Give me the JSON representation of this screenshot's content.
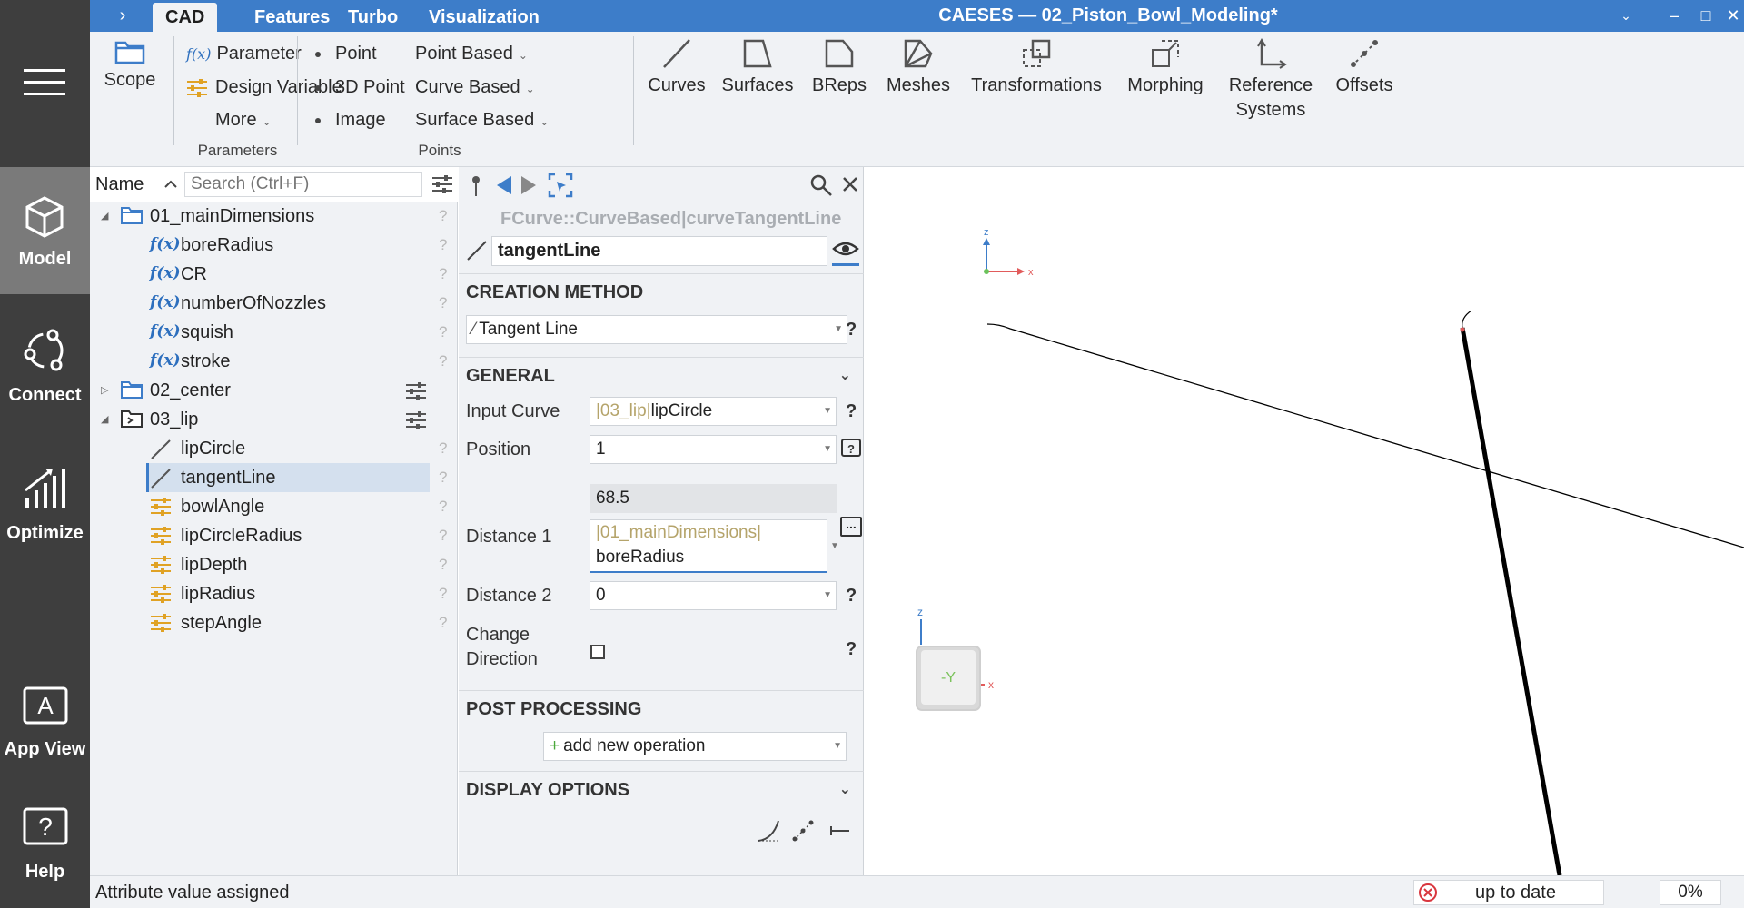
{
  "titlebar": {
    "tabs": [
      "CAD",
      "Features",
      "Turbo",
      "Visualization"
    ],
    "title": "CAESES — 02_Piston_Bowl_Modeling*"
  },
  "sidebar": {
    "items": [
      {
        "label": "Model",
        "icon": "cube-icon"
      },
      {
        "label": "Connect",
        "icon": "connect-icon"
      },
      {
        "label": "Optimize",
        "icon": "optimize-chart-icon"
      },
      {
        "label": "App View",
        "icon": "app-view-icon"
      },
      {
        "label": "Help",
        "icon": "help-icon"
      }
    ]
  },
  "ribbon": {
    "scope": "Scope",
    "parameter": "Parameter",
    "design_variable": "Design Variable",
    "more": "More",
    "group_parameters": "Parameters",
    "point": "Point",
    "point_3d": "3D Point",
    "image": "Image",
    "point_based": "Point Based",
    "curve_based": "Curve Based",
    "surface_based": "Surface Based",
    "group_points": "Points",
    "curves": "Curves",
    "surfaces": "Surfaces",
    "breps": "BReps",
    "meshes": "Meshes",
    "transformations": "Transformations",
    "morphing": "Morphing",
    "reference_systems_1": "Reference",
    "reference_systems_2": "Systems",
    "offsets": "Offsets"
  },
  "tree": {
    "name_header": "Name",
    "search_placeholder": "Search (Ctrl+F)",
    "items": [
      {
        "label": "01_mainDimensions",
        "kind": "folder"
      },
      {
        "label": "boreRadius",
        "kind": "parameter"
      },
      {
        "label": "CR",
        "kind": "parameter"
      },
      {
        "label": "numberOfNozzles",
        "kind": "parameter"
      },
      {
        "label": "squish",
        "kind": "parameter"
      },
      {
        "label": "stroke",
        "kind": "parameter"
      },
      {
        "label": "02_center",
        "kind": "folder"
      },
      {
        "label": "03_lip",
        "kind": "folder"
      },
      {
        "label": "lipCircle",
        "kind": "curve"
      },
      {
        "label": "tangentLine",
        "kind": "curve"
      },
      {
        "label": "bowlAngle",
        "kind": "design-variable"
      },
      {
        "label": "lipCircleRadius",
        "kind": "design-variable"
      },
      {
        "label": "lipDepth",
        "kind": "design-variable"
      },
      {
        "label": "lipRadius",
        "kind": "design-variable"
      },
      {
        "label": "stepAngle",
        "kind": "design-variable"
      }
    ],
    "fx_label": "f(x)",
    "q": "?"
  },
  "props": {
    "type_path": "FCurve::CurveBased|curveTangentLine",
    "object_name": "tangentLine",
    "creation_method_title": "CREATION METHOD",
    "creation_method_value": "Tangent Line",
    "general_title": "GENERAL",
    "input_curve_label": "Input Curve",
    "input_curve_ref": "|03_lip|",
    "input_curve_value": "lipCircle",
    "position_label": "Position",
    "position_value": "1",
    "distance1_label": "Distance 1",
    "distance1_result": "68.5",
    "distance1_ref": "|01_mainDimensions|",
    "distance1_value": "boreRadius",
    "distance2_label": "Distance 2",
    "distance2_value": "0",
    "change_direction_label_1": "Change",
    "change_direction_label_2": "Direction",
    "post_processing_title": "POST PROCESSING",
    "add_operation": "add new operation",
    "display_options_title": "DISPLAY OPTIONS",
    "q": "?",
    "ellipsis": "..."
  },
  "viewport": {
    "axis_x": "x",
    "axis_z": "z",
    "cube_face": "-Y"
  },
  "status": {
    "message": "Attribute value assigned",
    "state": "up to date",
    "progress": "0%"
  },
  "colors": {
    "accent": "#3d7dc9",
    "sidebar": "#3e3e3e",
    "sidebar_active": "#7a7a7a",
    "design_variable": "#e0a224",
    "reference_text": "#b5a46b",
    "error_icon": "#d9363e"
  }
}
